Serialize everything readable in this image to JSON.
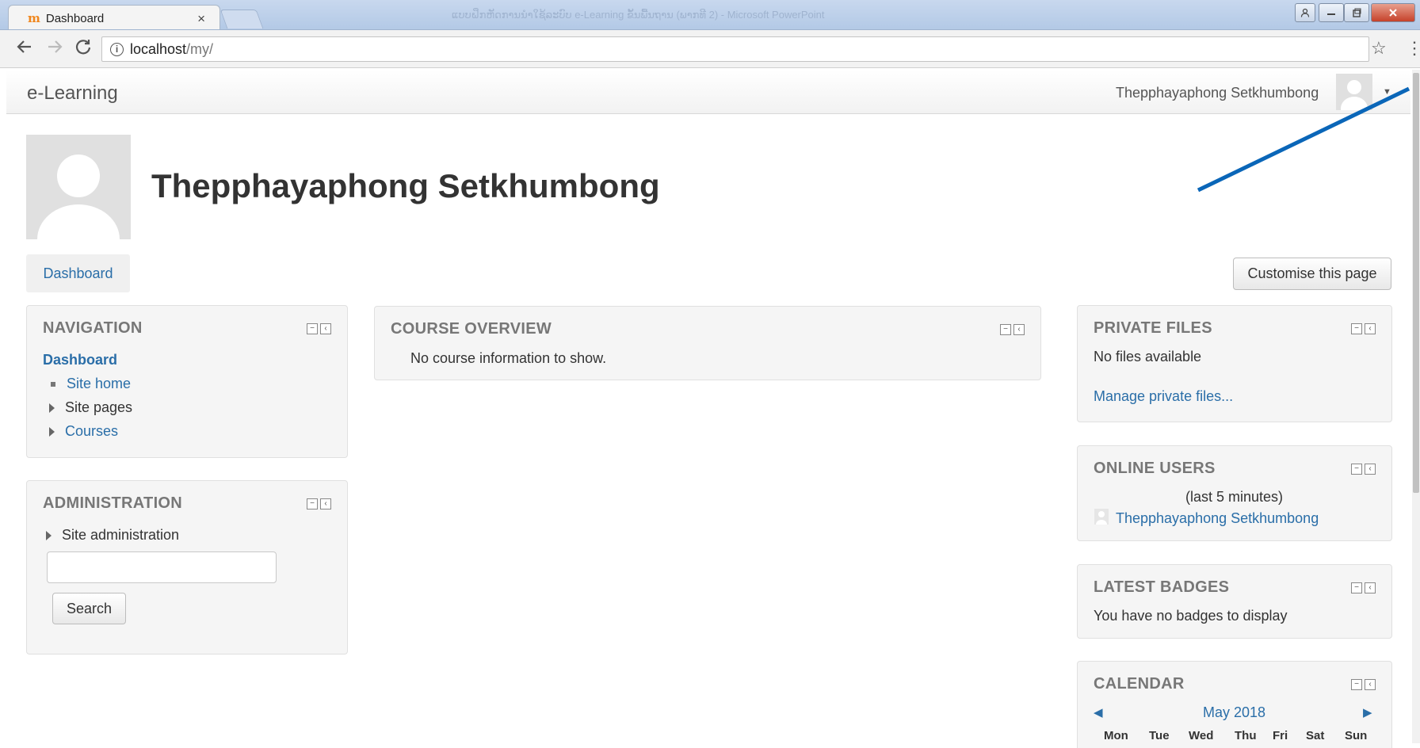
{
  "browser": {
    "tab_title": "Dashboard",
    "tab_close": "×",
    "window_title": "ແບບຝຶກຫັດການນຳໃຊ້ລະບົບ e-Learning ຂັ້ນພື້ນຖານ (ພາກທີ 2) - Microsoft PowerPoint",
    "url_host": "localhost",
    "url_path": "/my/"
  },
  "site": {
    "brand": "e-Learning",
    "user_name": "Thepphayaphong Setkhumbong"
  },
  "header": {
    "title": "Thepphayaphong Setkhumbong",
    "tab_label": "Dashboard",
    "customise_label": "Customise this page"
  },
  "navigation": {
    "title": "NAVIGATION",
    "current": "Dashboard",
    "items": [
      {
        "label": "Site home"
      },
      {
        "label": "Site pages"
      },
      {
        "label": "Courses"
      }
    ]
  },
  "administration": {
    "title": "ADMINISTRATION",
    "item": "Site administration",
    "search_label": "Search",
    "search_value": ""
  },
  "course_overview": {
    "title": "COURSE OVERVIEW",
    "message": "No course information to show."
  },
  "private_files": {
    "title": "PRIVATE FILES",
    "message": "No files available",
    "link": "Manage private files..."
  },
  "online_users": {
    "title": "ONLINE USERS",
    "period": "(last 5 minutes)",
    "user": "Thepphayaphong Setkhumbong"
  },
  "latest_badges": {
    "title": "LATEST BADGES",
    "message": "You have no badges to display"
  },
  "calendar": {
    "title": "CALENDAR",
    "month": "May 2018",
    "days": [
      "Mon",
      "Tue",
      "Wed",
      "Thu",
      "Fri",
      "Sat",
      "Sun"
    ]
  },
  "colors": {
    "link": "#2a6ea8",
    "annotation_arrow": "#0a66b8"
  }
}
